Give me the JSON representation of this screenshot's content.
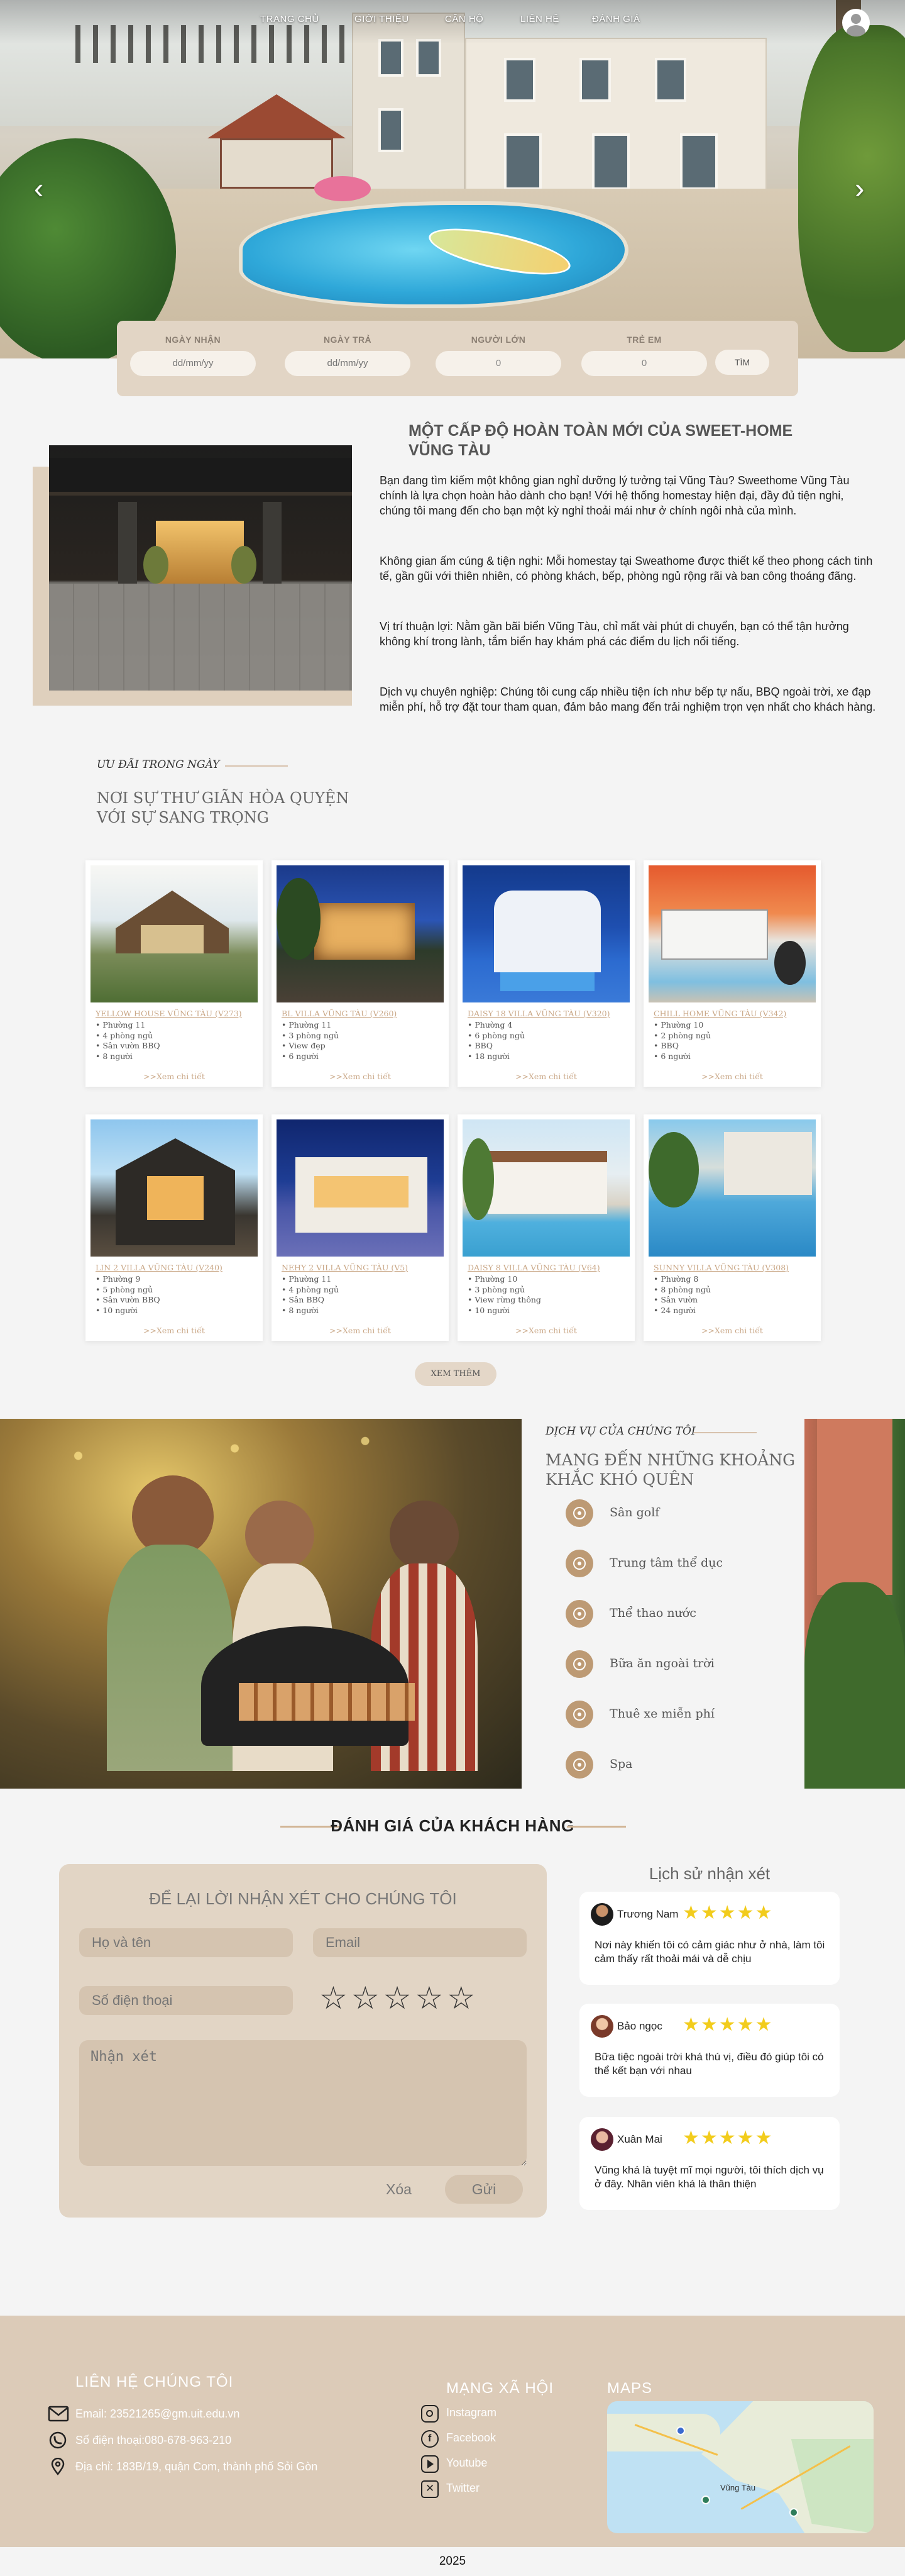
{
  "nav": {
    "items": [
      "TRANG CHỦ",
      "GIỚI THIỆU",
      "CĂN HỘ",
      "LIÊN HỆ",
      "ĐÁNH GIÁ"
    ]
  },
  "booking": {
    "checkin_label": "NGÀY NHẬN",
    "checkin_placeholder": "dd/mm/yy",
    "checkout_label": "NGÀY TRẢ",
    "checkout_placeholder": "dd/mm/yy",
    "adults_label": "NGƯỜI LỚN",
    "adults_value": "0",
    "children_label": "TRẺ EM",
    "children_value": "0",
    "search_label": "TÌM"
  },
  "about": {
    "title": "MỘT CẤP ĐỘ HOÀN TOÀN MỚI CỦA SWEET-HOME VŨNG TÀU",
    "paragraphs": [
      "Bạn đang tìm kiếm một không gian nghỉ dưỡng lý tưởng tại Vũng Tàu? Sweethome Vũng Tàu chính là lựa chọn hoàn hảo dành cho bạn! Với hệ thống homestay hiện đại, đầy đủ tiện nghi, chúng tôi mang đến cho bạn một kỳ nghỉ thoải mái như ở chính ngôi nhà của mình.",
      "Không gian ấm cúng & tiện nghi: Mỗi homestay tại Sweathome được thiết kế theo phong cách tinh tế, gần gũi với thiên nhiên, có phòng khách, bếp, phòng ngủ rộng rãi và ban công thoáng đãng.",
      "Vị trí thuận lợi: Nằm gần bãi biển Vũng Tàu, chỉ mất vài phút di chuyển, bạn có thể tận hưởng không khí trong lành, tắm biển hay khám phá các điểm du lịch nổi tiếng.",
      "Dịch vụ chuyên nghiệp: Chúng tôi cung cấp nhiều tiện ích như bếp tự nấu, BBQ ngoài trời, xe đạp miễn phí, hỗ trợ đặt tour tham quan, đảm bảo mang đến trải nghiệm trọn vẹn nhất cho khách hàng."
    ]
  },
  "deals": {
    "subtitle": "ƯU ĐÃI TRONG NGÀY",
    "heading_line1": "NƠI SỰ THƯ GIÃN HÒA QUYỆN",
    "heading_line2": "VỚI SỰ SANG TRỌNG",
    "more_label": "XEM THÊM",
    "detail_label": ">>Xem chi tiết",
    "cards": [
      {
        "name": "YELLOW HOUSE VŨNG TÀU (V273)",
        "features": [
          "Phường 11",
          "4 phòng ngủ",
          "Sân vườn BBQ",
          "8 người"
        ]
      },
      {
        "name": "BL VILLA VŨNG TÀU (V260)",
        "features": [
          "Phường 11",
          "3 phòng ngủ",
          "View đẹp",
          "6 người"
        ]
      },
      {
        "name": "DAISY 18 VILLA VŨNG TÀU (V320)",
        "features": [
          "Phường 4",
          "6 phòng ngủ",
          "BBQ",
          "18 người"
        ]
      },
      {
        "name": "CHILL HOME VŨNG TÀU (V342)",
        "features": [
          "Phường 10",
          "2 phòng ngủ",
          "BBQ",
          "6 người"
        ]
      },
      {
        "name": "LIN 2 VILLA VŨNG TÀU (V240)",
        "features": [
          "Phường 9",
          "5 phòng ngủ",
          "Sân vườn BBQ",
          "10 người"
        ]
      },
      {
        "name": "NEHY 2 VILLA VŨNG TÀU (V5)",
        "features": [
          "Phường 11",
          "4 phòng ngủ",
          "Sân BBQ",
          "8 người"
        ]
      },
      {
        "name": "DAISY 8 VILLA VŨNG TÀU (V64)",
        "features": [
          "Phường 10",
          "3 phòng ngủ",
          "View rừng thông",
          "10 người"
        ]
      },
      {
        "name": "SUNNY VILLA VŨNG TÀU (V308)",
        "features": [
          "Phường 8",
          "8 phòng ngủ",
          "Sân vườn",
          "24 người"
        ]
      }
    ]
  },
  "services": {
    "subtitle": "DỊCH VỤ CỦA CHÚNG TÔI",
    "heading_line1": "MANG ĐẾN NHỮNG KHOẢNG",
    "heading_line2": "KHẮC KHÓ QUÊN",
    "items": [
      "Sân golf",
      "Trung tâm thể dục",
      "Thể thao nước",
      "Bữa ăn ngoài trời",
      "Thuê xe miễn phí",
      "Spa"
    ]
  },
  "reviews": {
    "title": "ĐÁNH GIÁ CỦA KHÁCH HÀNG",
    "form": {
      "title": "ĐỂ LẠI LỜI NHẬN XÉT CHO CHÚNG TÔI",
      "name_placeholder": "Họ và tên",
      "email_placeholder": "Email",
      "phone_placeholder": "Số điện thoại",
      "comment_placeholder": "Nhận xét",
      "rating": 0,
      "cancel_label": "Xóa",
      "submit_label": "Gửi"
    },
    "history_title": "Lịch sử nhận xét",
    "history": [
      {
        "name": "Trương Nam",
        "stars": 5,
        "text": "Nơi này khiến tôi có cảm giác như ở nhà, làm tôi cảm thấy rất thoải mái và dễ chịu"
      },
      {
        "name": "Bảo ngọc",
        "stars": 5,
        "text": "Bữa tiệc ngoài trời khá thú vị, điều đó giúp tôi có thể kết bạn với nhau"
      },
      {
        "name": "Xuân Mai",
        "stars": 5,
        "text": "Vũng khá là tuyệt mĩ mọi người, tôi thích dịch vụ ở đây. Nhân viên khá là thân thiện"
      }
    ]
  },
  "footer": {
    "contact_title": "LIÊN HỆ CHÚNG TÔI",
    "email": "Email: 23521265@gm.uit.edu.vn",
    "phone": "Số điện thoại:080-678-963-210",
    "address": "Địa chỉ: 183B/19, quận Com, thành phố Sỏi Gòn",
    "social_title": "MẠNG XÃ HỘI",
    "socials": [
      "Instagram",
      "Facebook",
      "Youtube",
      "Twitter"
    ],
    "maps_title": "MAPS",
    "map_labels": [
      "Vũng Tàu"
    ],
    "copyright": "2025"
  },
  "colors": {
    "accent": "#bd9a74",
    "beige_panel": "#e2d5c5",
    "footer_bg": "#dccbb8",
    "star": "#f2cc1c",
    "link": "#caa888"
  }
}
